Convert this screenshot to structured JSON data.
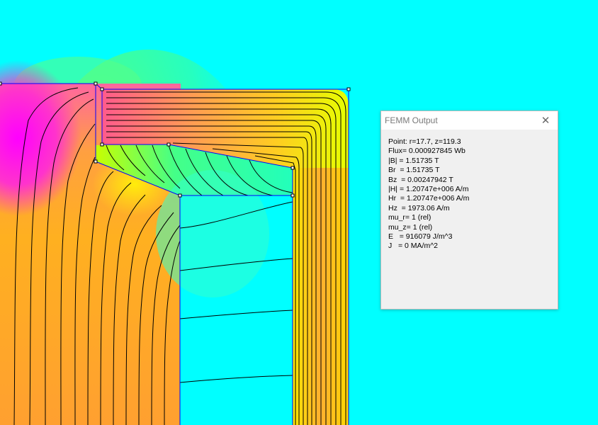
{
  "window": {
    "title": "FEMM Output",
    "close_glyph": "✕"
  },
  "readout": [
    "Point: r=17.7, z=119.3",
    "Flux= 0.000927845 Wb",
    "|B| = 1.51735 T",
    "Br  = 1.51735 T",
    "Bz  = 0.00247942 T",
    "|H| = 1.20747e+006 A/m",
    "Hr  = 1.20747e+006 A/m",
    "Hz  = 1973.06 A/m",
    "mu_r= 1 (rel)",
    "mu_z= 1 (rel)",
    "E   = 916079 J/m^3",
    "J   = 0 MA/m^2"
  ],
  "colors": {
    "background": "#00ffff",
    "boundary": "#0000ff",
    "contour": "#000000",
    "node": "#000000"
  }
}
